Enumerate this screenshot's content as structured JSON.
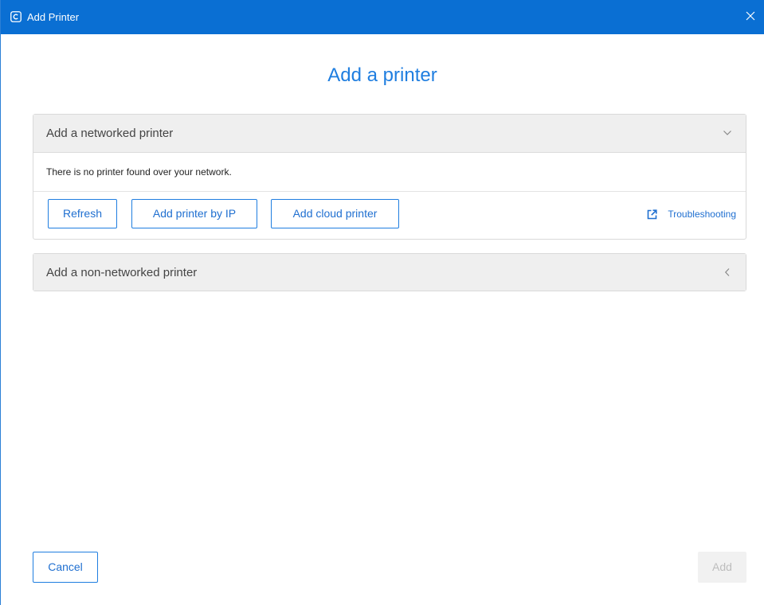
{
  "window": {
    "title": "Add Printer",
    "app_icon": "c-logo-icon",
    "close_icon": "close-icon"
  },
  "page": {
    "heading": "Add a printer"
  },
  "networked": {
    "header_label": "Add a networked printer",
    "chevron_icon": "chevron-down-icon",
    "status_text": "There is no printer found over your network.",
    "buttons": {
      "refresh": "Refresh",
      "add_by_ip": "Add printer by IP",
      "add_cloud": "Add cloud printer"
    },
    "troubleshoot_label": "Troubleshooting",
    "troubleshoot_icon": "external-link-icon"
  },
  "non_networked": {
    "header_label": "Add a non-networked printer",
    "chevron_icon": "chevron-left-icon"
  },
  "footer": {
    "cancel_label": "Cancel",
    "add_label": "Add"
  },
  "colors": {
    "titlebar": "#0a6fd3",
    "accent": "#1f7ee0",
    "header_bg": "#efefef",
    "disabled_bg": "#f1f1f1"
  }
}
